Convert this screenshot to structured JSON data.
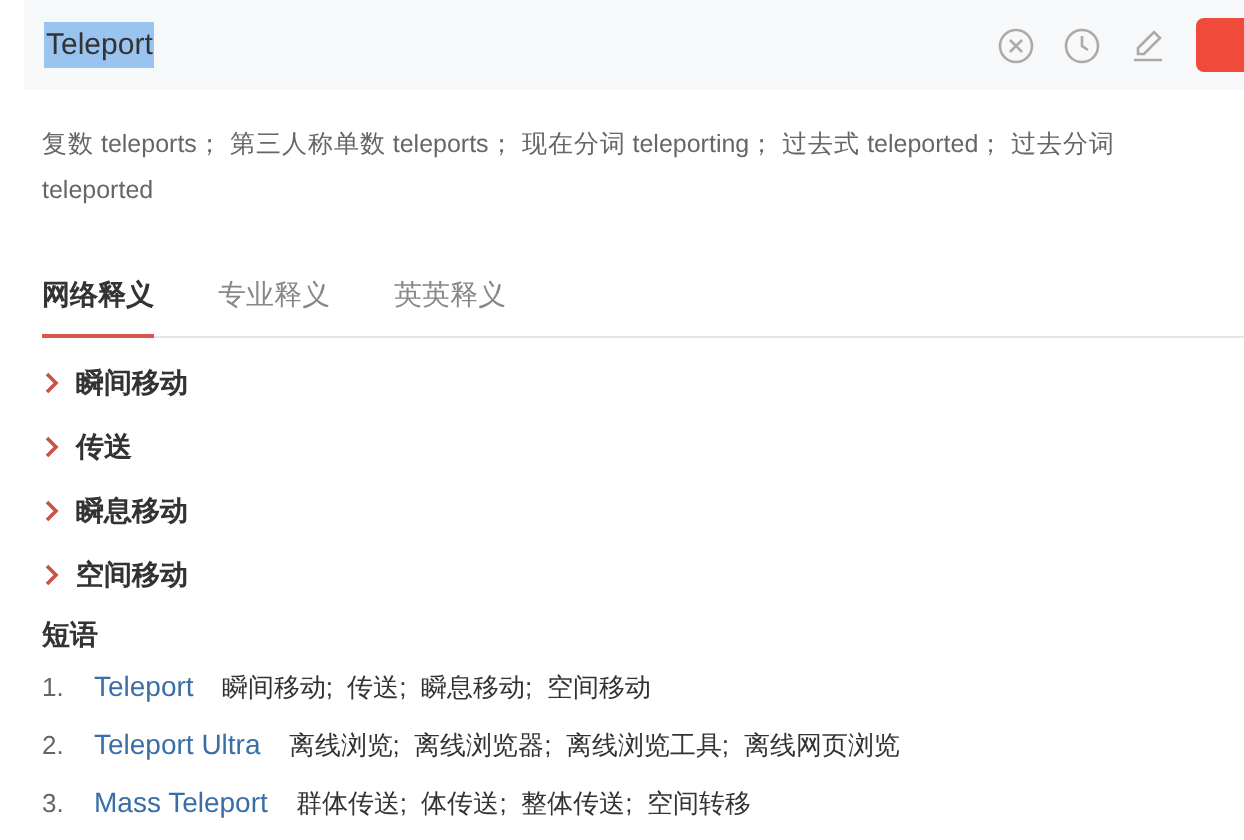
{
  "search": {
    "value": "Teleport",
    "selected": true
  },
  "word_forms": "复数 teleports；  第三人称单数 teleports；  现在分词 teleporting；  过去式 teleported；  过去分词 teleported",
  "tabs": [
    {
      "label": "网络释义",
      "selected": true
    },
    {
      "label": "专业释义",
      "selected": false
    },
    {
      "label": "英英释义",
      "selected": false
    }
  ],
  "definitions": [
    "瞬间移动",
    "传送",
    "瞬息移动",
    "空间移动"
  ],
  "phrases_heading": "短语",
  "phrases": [
    {
      "number": "1.",
      "phrase": "Teleport",
      "meaning": "瞬间移动;  传送;  瞬息移动;  空间移动"
    },
    {
      "number": "2.",
      "phrase": "Teleport Ultra",
      "meaning": "离线浏览;  离线浏览器;  离线浏览工具;  离线网页浏览"
    },
    {
      "number": "3.",
      "phrase": "Mass Teleport",
      "meaning": "群体传送;  体传送;  整体传送;  空间转移"
    }
  ]
}
